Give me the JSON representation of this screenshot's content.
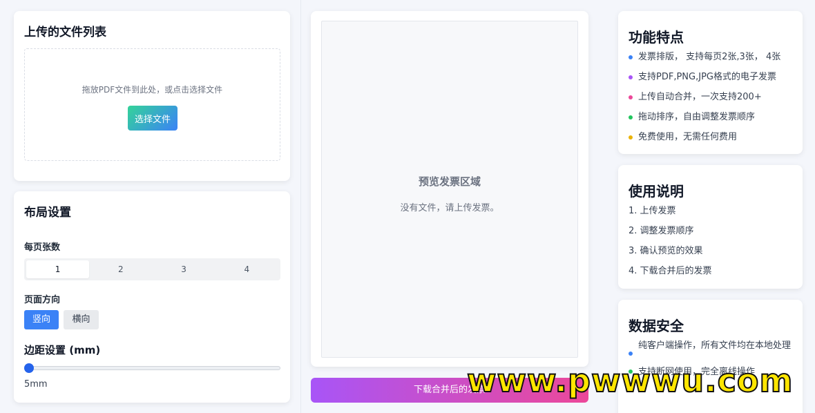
{
  "upload": {
    "title": "上传的文件列表",
    "dropzone_text": "拖放PDF文件到此处，或点击选择文件",
    "select_label": "选择文件"
  },
  "layout": {
    "title": "布局设置",
    "per_page_label": "每页张数",
    "per_page_options": [
      "1",
      "2",
      "3",
      "4"
    ],
    "per_page_selected": "1",
    "orientation_label": "页面方向",
    "orientation_portrait": "竖向",
    "orientation_landscape": "横向",
    "orientation_selected": "竖向",
    "margin_label": "边距设置 (mm)",
    "margin_value_text": "5mm",
    "margin_slider_fraction": 0.0
  },
  "preview": {
    "title": "预览发票区域",
    "subtitle": "没有文件，请上传发票。",
    "download_label": "下载合并后的发票"
  },
  "features": {
    "title": "功能特点",
    "items": [
      {
        "text": "发票排版， 支持每页2张,3张， 4张",
        "color": "#3b82f6"
      },
      {
        "text": "支持PDF,PNG,JPG格式的电子发票",
        "color": "#a855f7"
      },
      {
        "text": "上传自动合并，一次支持200+",
        "color": "#ec4899"
      },
      {
        "text": "拖动排序，自由调整发票顺序",
        "color": "#22c55e"
      },
      {
        "text": "免费使用，无需任何费用",
        "color": "#eab308"
      }
    ]
  },
  "usage": {
    "title": "使用说明",
    "items": [
      "1. 上传发票",
      "2. 调整发票顺序",
      "3. 确认预览的效果",
      "4. 下载合并后的发票"
    ]
  },
  "security": {
    "title": "数据安全",
    "items": [
      {
        "text": "纯客户端操作，所有文件均在本地处理",
        "color": "#3b82f6"
      },
      {
        "text": "支持断网使用，完全离线操作",
        "color": "#22c55e"
      }
    ]
  },
  "watermark": {
    "text": "www.pwwwu.com"
  }
}
